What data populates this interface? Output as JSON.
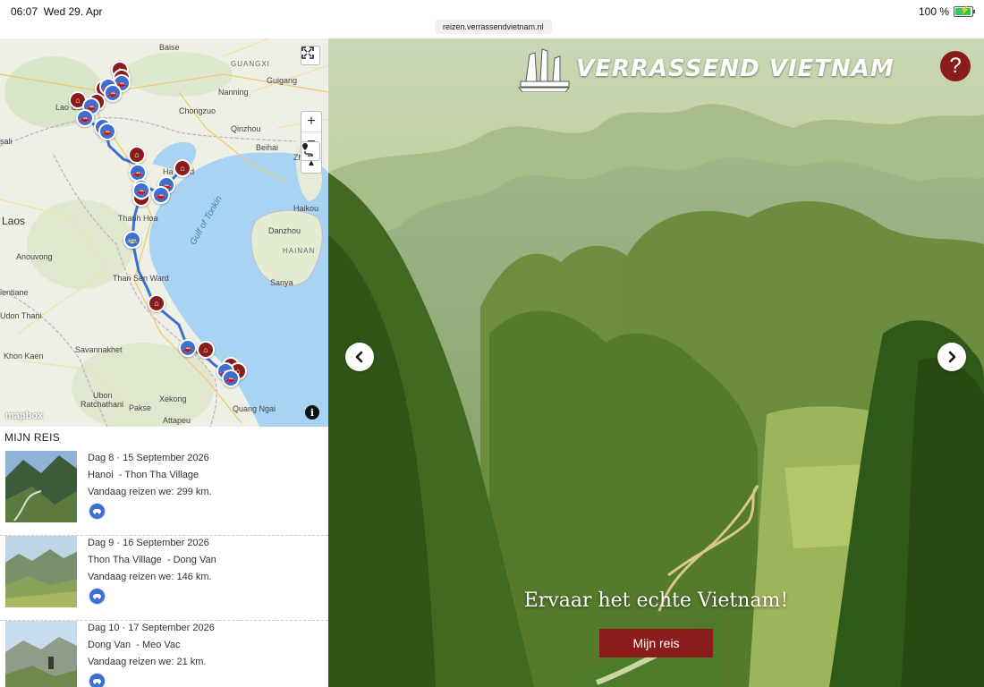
{
  "status_bar": {
    "time": "06:07",
    "date": "Wed 29. Apr",
    "url": "reizen.verrassendvietnam.nl",
    "battery": "100 %"
  },
  "map": {
    "labels": {
      "baise": "Baise",
      "guangxi": "GUANGXI",
      "guiguang": "Guigang",
      "nanning": "Nanning",
      "chongzuo": "Chongzuo",
      "lao_cai": "Lao Cai",
      "sali": "sali",
      "qinzhou": "Qinzhou",
      "beihai": "Beihai",
      "zhan": "Zh",
      "ha_ward": "Ha     Ward",
      "laos": "Laos",
      "thanh_hoa": "Thanh Hoa",
      "gulf": "Gulf of Tonkin",
      "haikou": "Haikou",
      "danzhou": "Danzhou",
      "hainan": "HAINAN",
      "anouvong": "Anouvong",
      "than_sen": "Than  Sen Ward",
      "vientiane": "ientiane",
      "udon": "Udon Thani",
      "sanya": "Sanya",
      "savannakhet": "Savannakhet",
      "khon_kaen": "Khon Kaen",
      "ubon": "Ubon",
      "ratchathani": "Ratchathani",
      "pakse": "Pakse",
      "xekong": "Xekong",
      "attapeu": "Attapeu",
      "quang_ngai": "Quang Ngai"
    },
    "attribution": "mapbox",
    "controls": {
      "expand_icon": "fullscreen-icon",
      "zoom_in": "+",
      "zoom_out": "−",
      "compass": "▲",
      "locate_icon": "route-pin-icon",
      "info": "i"
    }
  },
  "trip": {
    "title": "MIJN REIS",
    "days": [
      {
        "date": "Dag 8 · 15 September 2026",
        "route": "Hanoi  - Thon Tha Village",
        "distance": "Vandaag reizen we:  299 km.",
        "transport_icon": "car-icon"
      },
      {
        "date": "Dag 9 · 16 September 2026",
        "route": "Thon Tha Village  - Dong Van",
        "distance": "Vandaag reizen we:  146 km.",
        "transport_icon": "car-icon"
      },
      {
        "date": "Dag 10 · 17 September 2026",
        "route": "Dong Van  - Meo Vac",
        "distance": "Vandaag reizen we:  21 km.",
        "transport_icon": "car-icon"
      }
    ]
  },
  "hero": {
    "logo_text": "VERRASSEND VIETNAM",
    "help_label": "?",
    "headline": "Ervaar het echte Vietnam!",
    "cta_label": "Mijn reis"
  }
}
